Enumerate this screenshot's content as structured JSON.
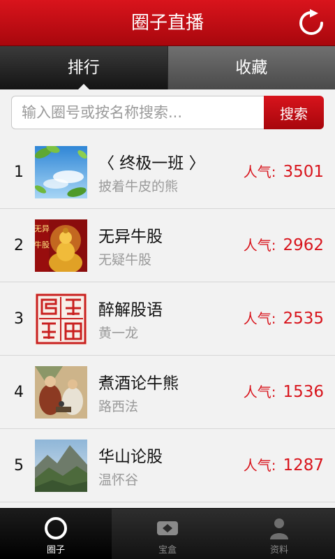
{
  "titlebar": {
    "title": "圈子直播",
    "refresh_icon": "refresh-icon"
  },
  "tabs": [
    {
      "label": "排行",
      "active": true
    },
    {
      "label": "收藏",
      "active": false
    }
  ],
  "search": {
    "placeholder": "输入圈号或按名称搜索...",
    "value": "",
    "button_label": "搜索"
  },
  "list": {
    "popularity_label": "人气:",
    "items": [
      {
        "rank": "1",
        "name": "〈 终极一班 〉",
        "owner": "披着牛皮的熊",
        "popularity": "3501",
        "thumb": "sky-leaves-image"
      },
      {
        "rank": "2",
        "name": "无异牛股",
        "owner": "无疑牛股",
        "popularity": "2962",
        "thumb": "golden-buddha-image",
        "thumb_text": [
          "无异",
          "牛股"
        ]
      },
      {
        "rank": "3",
        "name": "醉解股语",
        "owner": "黄一龙",
        "popularity": "2535",
        "thumb": "red-seal-image"
      },
      {
        "rank": "4",
        "name": "煮酒论牛熊",
        "owner": "路西法",
        "popularity": "1536",
        "thumb": "ancient-painting-image"
      },
      {
        "rank": "5",
        "name": "华山论股",
        "owner": "温怀谷",
        "popularity": "1287",
        "thumb": "mountain-image"
      }
    ]
  },
  "bottom_nav": [
    {
      "label": "圈子",
      "icon": "circle-icon",
      "active": true
    },
    {
      "label": "宝盒",
      "icon": "box-icon",
      "active": false
    },
    {
      "label": "资料",
      "icon": "profile-icon",
      "active": false
    }
  ],
  "colors": {
    "brand_red": "#d8141c",
    "muted_text": "#9a9a9a"
  }
}
